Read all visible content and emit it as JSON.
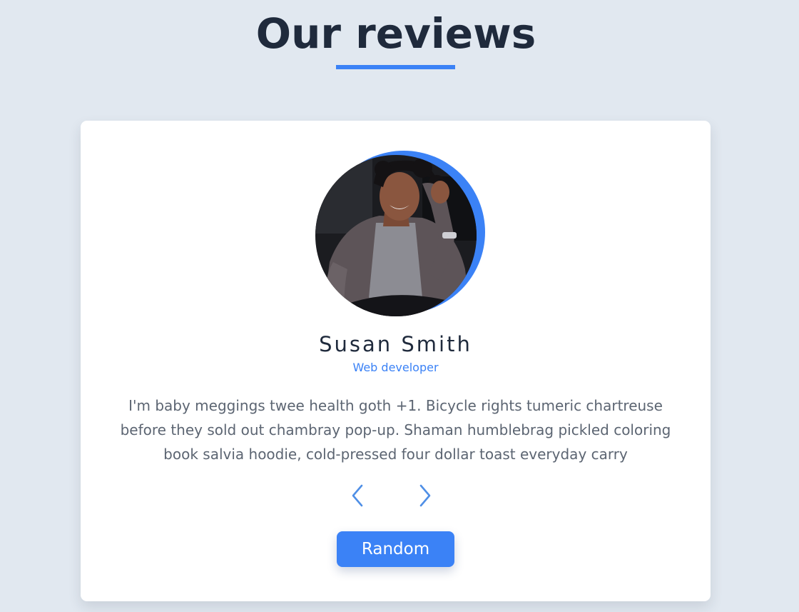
{
  "header": {
    "title": "Our reviews"
  },
  "review": {
    "name": "Susan Smith",
    "job": "Web developer",
    "text": "I'm baby meggings twee health goth +1. Bicycle rights tumeric chartreuse before they sold out chambray pop-up. Shaman humblebrag pickled coloring book salvia hoodie, cold-pressed four dollar toast everyday carry",
    "avatar_alt": "Susan Smith"
  },
  "controls": {
    "prev_icon": "chevron-left-icon",
    "next_icon": "chevron-right-icon",
    "random_label": "Random"
  },
  "colors": {
    "accent": "#3b82f6",
    "background": "#e1e8f0",
    "title": "#1f2a3c",
    "body_text": "#5c6572"
  }
}
